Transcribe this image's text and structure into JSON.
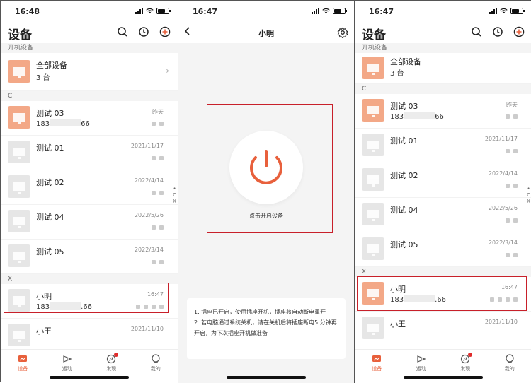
{
  "status_time": "16:48",
  "status_time_detail": "16:47",
  "list": {
    "title": "设备",
    "sections": {
      "on": "开机设备",
      "c": "C",
      "x": "X"
    },
    "all_devices": {
      "name": "全部设备",
      "count": "3 台"
    },
    "devices": [
      {
        "name": "测试 03",
        "phone_prefix": "183",
        "phone_suffix": "66",
        "date": "昨天",
        "active": true
      },
      {
        "name": "测试 01",
        "date": "2021/11/17",
        "active": false
      },
      {
        "name": "测试 02",
        "date": "2022/4/14",
        "active": false
      },
      {
        "name": "测试 04",
        "date": "2022/5/26",
        "active": false
      },
      {
        "name": "测试 05",
        "date": "2022/3/14",
        "active": false
      },
      {
        "name": "小明",
        "phone_prefix": "183",
        "phone_suffix": ".66",
        "date": "16:47",
        "active": false
      },
      {
        "name": "小王",
        "date": "2021/11/10",
        "active": false
      }
    ],
    "tabs": [
      "设备",
      "运动",
      "发现",
      "我的"
    ],
    "side_label": [
      "C",
      "X"
    ]
  },
  "list_right": {
    "xiaoming_thumb_orange": true
  },
  "detail": {
    "title": "小明",
    "power_label": "点击开启设备",
    "tip1": "1. 插座已开启，使用插座开机，插座将自动断电重开",
    "tip2": "2. 若电脑通过系统关机，请在关机后将插座断电5 分钟再开启，为下次插座开机做准备"
  },
  "colors": {
    "accent": "#e8603c",
    "highlight_box": "#c8202a",
    "thumb_active": "#f3a887"
  },
  "icons": [
    "search-icon",
    "history-icon",
    "add-icon",
    "chevron-right-icon",
    "back-icon",
    "gear-icon",
    "power-icon"
  ]
}
